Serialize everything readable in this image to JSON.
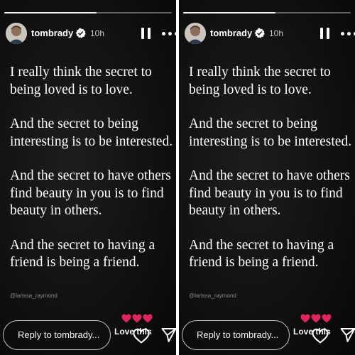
{
  "stories": [
    {
      "progress": 0.55,
      "username": "tombrady",
      "time": "10h",
      "quote_paragraphs": [
        "I really think the secret to being loved is to love.",
        "And the secret to being interesting is to be interested.",
        "And the secret to have others find beauty in you is to find beauty in others.",
        "And the secret to having a friend is being a friend."
      ],
      "credit": "@larissa_raymond",
      "reply_placeholder": "Reply to tombrady...",
      "reaction_label": "Love this",
      "reaction_emojis": [
        "heart",
        "heart",
        "heart"
      ]
    },
    {
      "progress": 0.55,
      "username": "tombrady",
      "time": "10h",
      "quote_paragraphs": [
        "I really think the secret to being loved is to love.",
        "And the secret to being interesting is to be interested.",
        "And the secret to have others find beauty in you is to find beauty in others.",
        "And the secret to having a friend is being a friend."
      ],
      "credit": "@larissa_raymond",
      "reply_placeholder": "Reply to tombrady...",
      "reaction_label": "Love this",
      "reaction_emojis": [
        "heart",
        "heart",
        "heart"
      ]
    }
  ],
  "icons": {
    "verified": "verified-badge-icon",
    "pause": "pause-icon",
    "more": "more-options-icon",
    "like": "heart-outline-icon",
    "send": "send-icon"
  },
  "colors": {
    "background": "#111111",
    "text": "#ffffff",
    "verified_badge": "#ffffff",
    "heart_emoji": "#e0245e"
  }
}
